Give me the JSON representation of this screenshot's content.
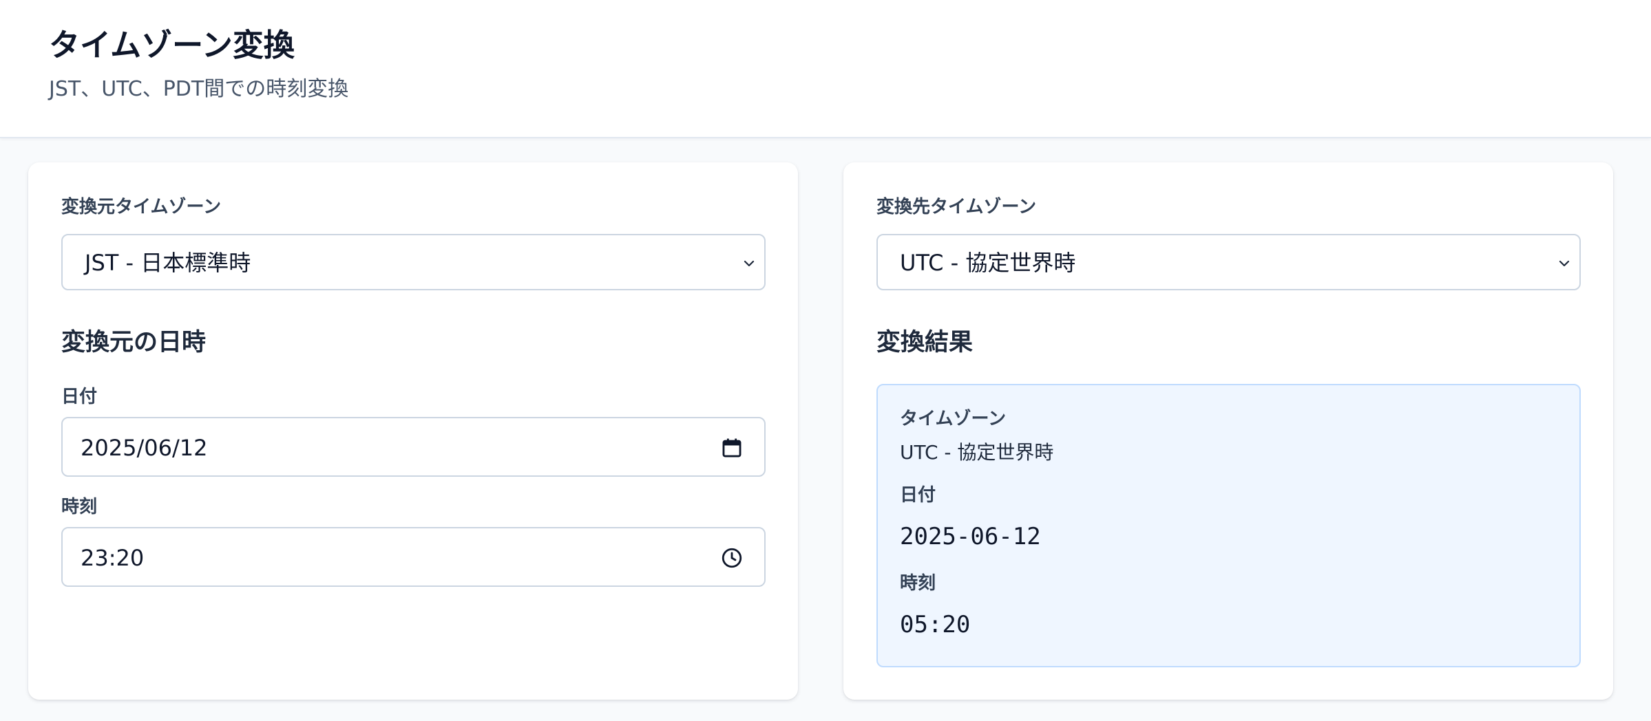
{
  "header": {
    "title": "タイムゾーン変換",
    "subtitle": "JST、UTC、PDT間での時刻変換"
  },
  "source": {
    "timezone_label": "変換元タイムゾーン",
    "timezone_value": "JST - 日本標準時",
    "section_title": "変換元の日時",
    "date_label": "日付",
    "date_value": "2025/06/12",
    "time_label": "時刻",
    "time_value": "23:20",
    "icons": [
      "chevron-down-icon",
      "calendar-icon",
      "clock-icon"
    ]
  },
  "target": {
    "timezone_label": "変換先タイムゾーン",
    "timezone_value": "UTC - 協定世界時",
    "section_title": "変換結果",
    "result": {
      "timezone_label": "タイムゾーン",
      "timezone_value": "UTC - 協定世界時",
      "date_label": "日付",
      "date_value": "2025-06-12",
      "time_label": "時刻",
      "time_value": "05:20"
    }
  },
  "colors": {
    "page_bg": "#f8fafc",
    "card_bg": "#ffffff",
    "result_bg": "#eff6ff",
    "result_border": "#bfdbfe",
    "input_border": "#cbd5e1"
  }
}
